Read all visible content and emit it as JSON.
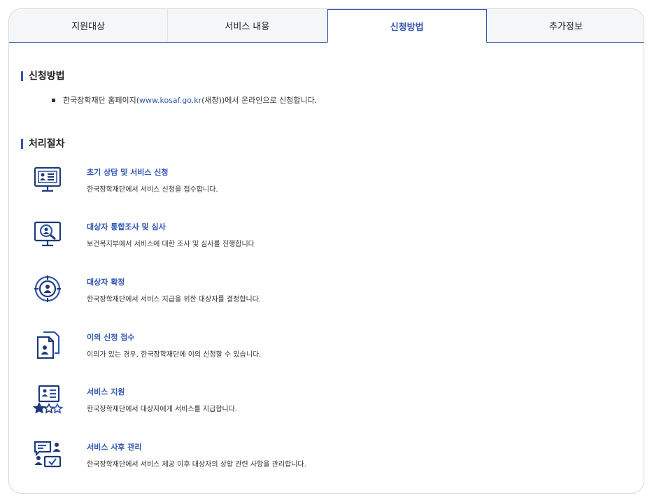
{
  "tabs": [
    {
      "label": "지원대상"
    },
    {
      "label": "서비스 내용"
    },
    {
      "label": "신청방법"
    },
    {
      "label": "추가정보"
    }
  ],
  "apply": {
    "heading": "신청방법",
    "line_prefix": "한국장학재단 홈페이지(",
    "line_link": "www.kosaf.go.kr",
    "line_suffix": "(새창))에서 온라인으로 신청합니다."
  },
  "process": {
    "heading": "처리절차",
    "steps": [
      {
        "title": "초기 상담 및 서비스 신청",
        "desc": "한국장학재단에서 서비스 신청을 접수합니다.",
        "icon": "monitor-profile-icon"
      },
      {
        "title": "대상자 통합조사 및 심사",
        "desc": "보건복지부에서 서비스에 대한 조사 및 심사를 진행합니다",
        "icon": "monitor-search-icon"
      },
      {
        "title": "대상자 확정",
        "desc": "한국장학재단에서 서비스 지급을 위한 대상자를 결정합니다.",
        "icon": "target-person-icon"
      },
      {
        "title": "이의 신청 접수",
        "desc": "이의가 있는 경우, 한국장학재단에 이의 신청할 수 있습니다.",
        "icon": "documents-person-icon"
      },
      {
        "title": "서비스 지원",
        "desc": "한국장학재단에서 대상자에게 서비스를 지급합니다.",
        "icon": "profile-stars-icon"
      },
      {
        "title": "서비스 사후 관리",
        "desc": "한국장학재단에서 서비스 제공 이후 대상자의 상황 관련 사항을 관리합니다.",
        "icon": "chat-people-check-icon"
      }
    ]
  },
  "colors": {
    "accent": "#2f56b0",
    "icon_dark": "#1f3a78"
  }
}
